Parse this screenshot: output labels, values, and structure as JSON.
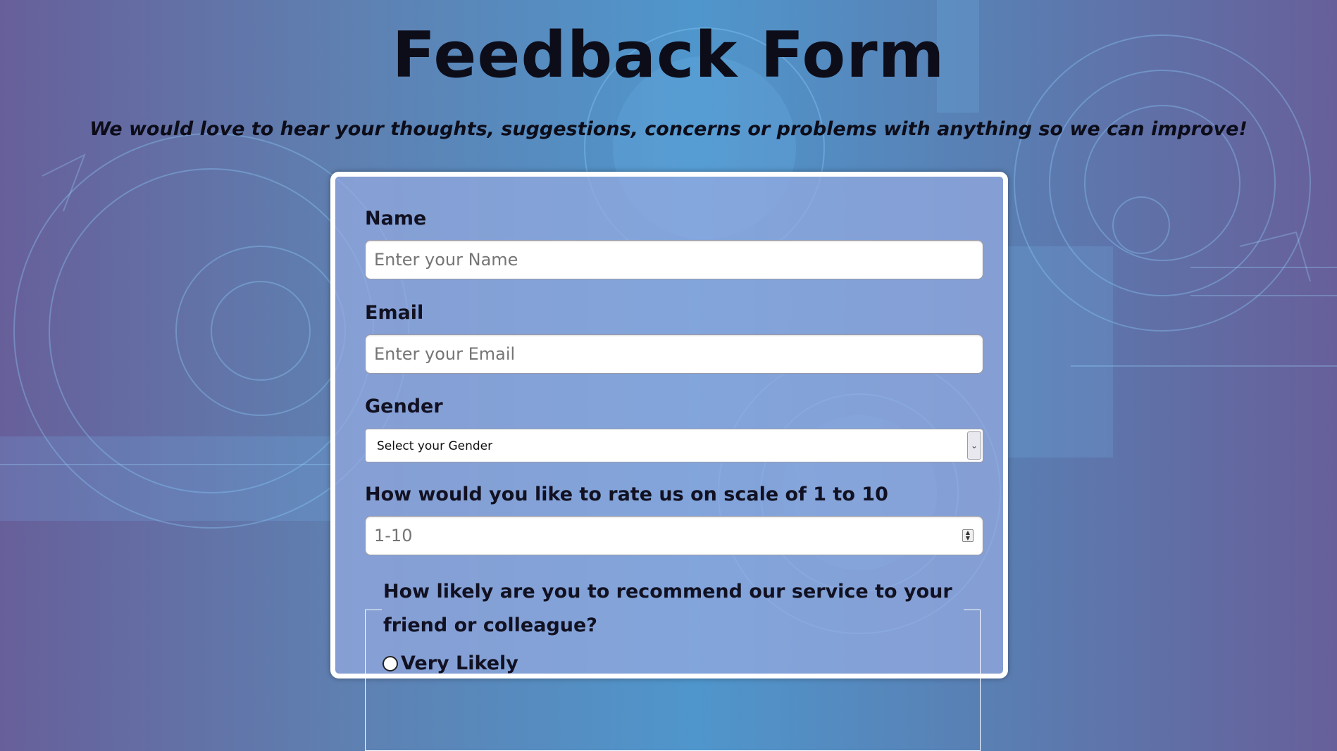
{
  "header": {
    "title": "Feedback Form",
    "subtitle": "We would love to hear your thoughts, suggestions, concerns or problems with anything so we can improve!"
  },
  "form": {
    "name": {
      "label": "Name",
      "placeholder": "Enter your Name"
    },
    "email": {
      "label": "Email",
      "placeholder": "Enter your Email"
    },
    "gender": {
      "label": "Gender",
      "selected": "Select your Gender"
    },
    "rating": {
      "label": "How would you like to rate us on scale of 1 to 10",
      "placeholder": "1-10"
    },
    "recommend": {
      "legend": "How likely are you to recommend our service to your friend or colleague?",
      "options": [
        "Very Likely"
      ]
    }
  },
  "colors": {
    "card_border": "#ffffff",
    "text": "#0d0d1a",
    "bg_center": "#4f96cc",
    "bg_edge": "#675f9a"
  },
  "icons": {
    "select_arrow": "chevron-down-icon",
    "spinner": "spinner-arrows-icon"
  }
}
